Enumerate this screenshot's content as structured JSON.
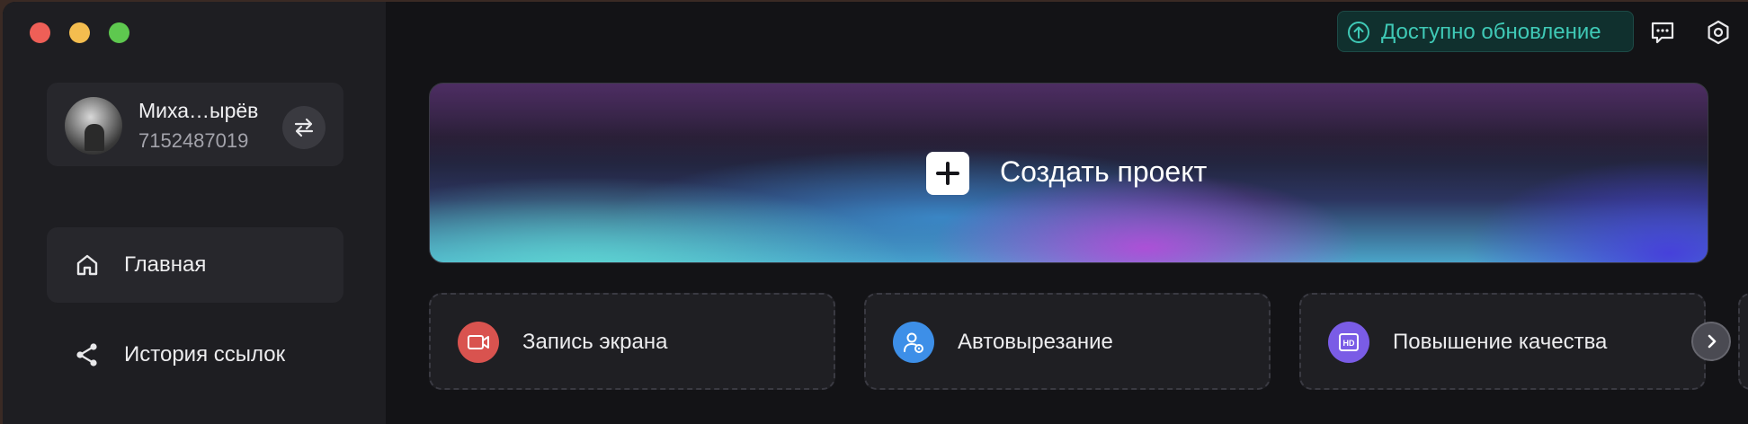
{
  "window": {
    "traffic_lights": [
      "close",
      "minimize",
      "zoom"
    ]
  },
  "account": {
    "name": "Миха…ырёв",
    "id": "7152487019",
    "switch_icon": "swap-arrows-icon"
  },
  "sidebar": {
    "items": [
      {
        "label": "Главная",
        "icon": "home-icon",
        "active": true
      },
      {
        "label": "История ссылок",
        "icon": "share-icon",
        "active": false
      }
    ]
  },
  "topbar": {
    "update_label": "Доступно обновление",
    "update_color": "#3fc9b6",
    "icons": [
      "feedback-icon",
      "settings-icon"
    ]
  },
  "create": {
    "label": "Создать проект",
    "icon": "plus-icon"
  },
  "tools": [
    {
      "label": "Запись экрана",
      "icon": "video-camera-icon",
      "color": "#d9534f"
    },
    {
      "label": "Автовырезание",
      "icon": "person-cutout-icon",
      "color": "#3d8fe8"
    },
    {
      "label": "Повышение качества",
      "icon": "hd-icon",
      "color": "#7a5ce6"
    }
  ],
  "tools_next_icon": "chevron-right-icon"
}
